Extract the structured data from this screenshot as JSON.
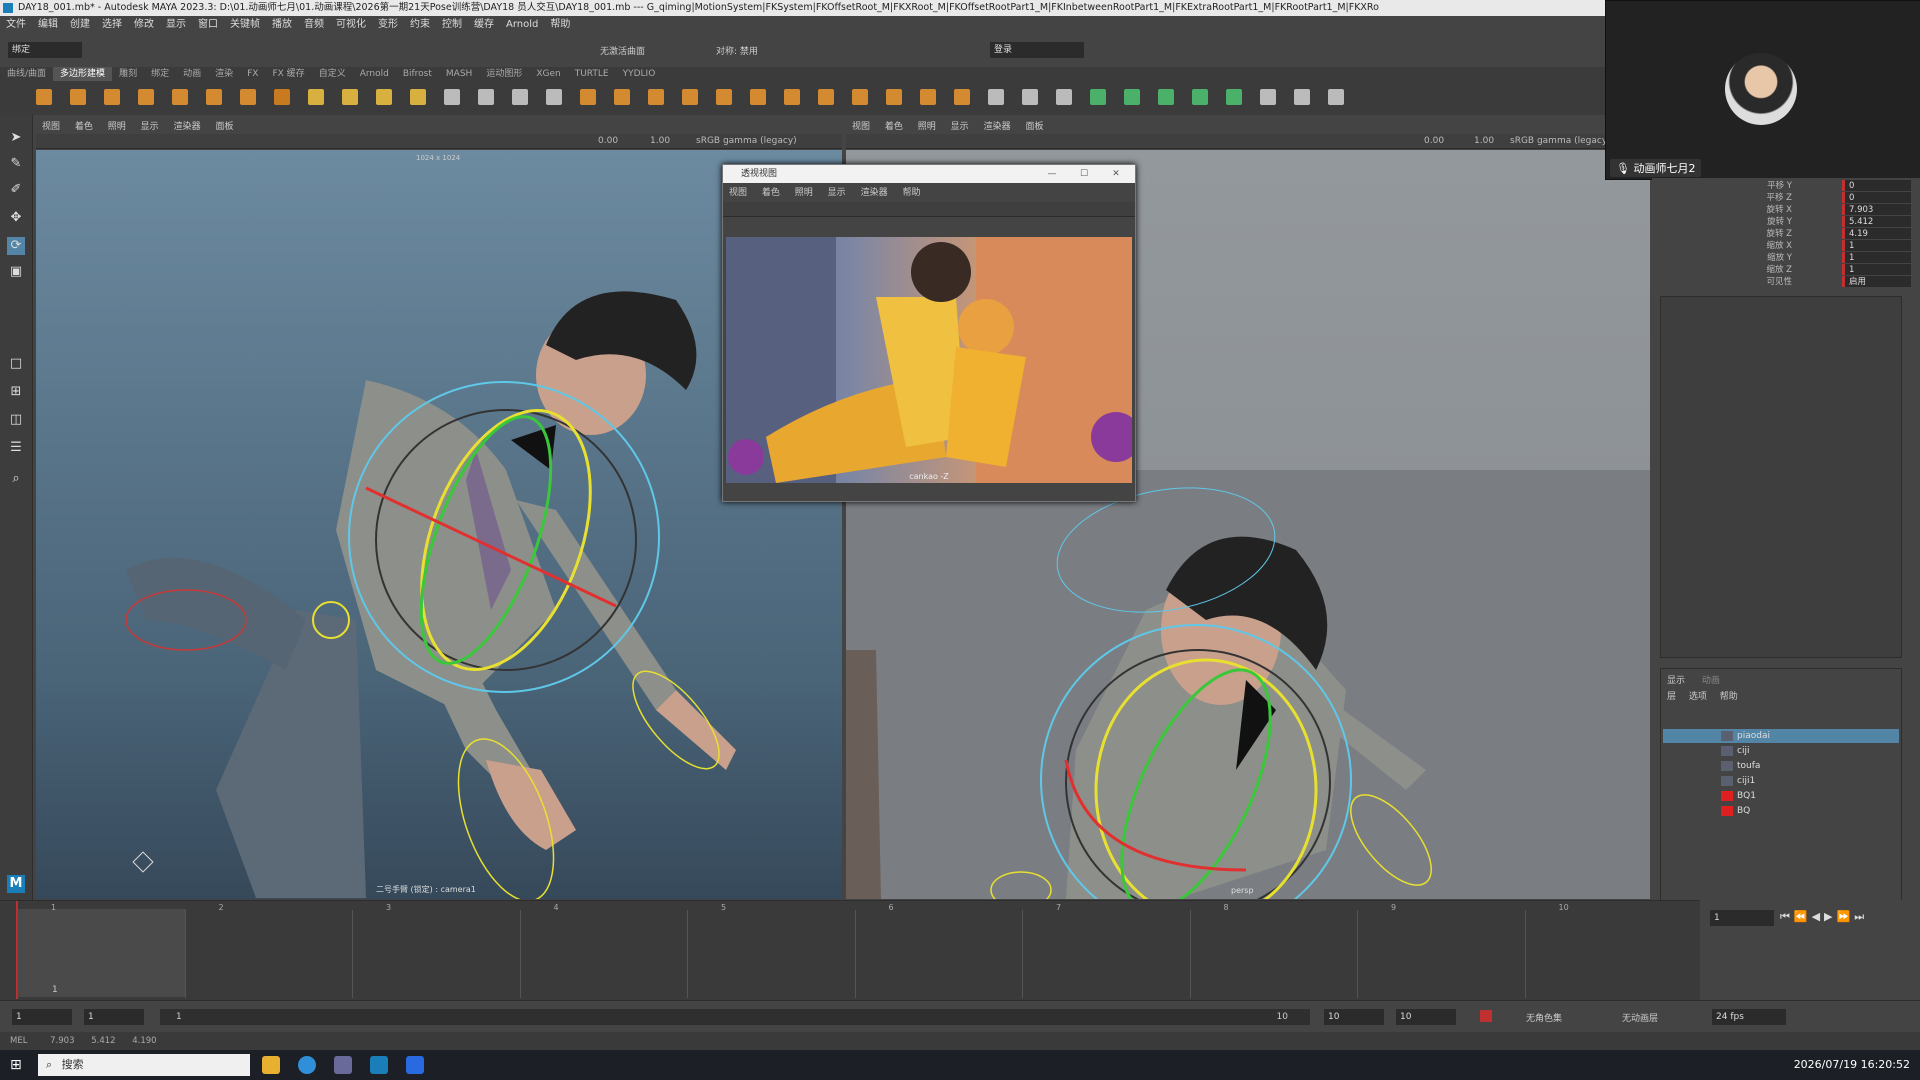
{
  "title_bar": "DAY18_001.mb* - Autodesk MAYA 2023.3: D:\\01.动画师七月\\01.动画课程\\2026第一期21天Pose训练营\\DAY18 员人交互\\DAY18_001.mb  ---  G_qiming|MotionSystem|FKSystem|FKOffsetRoot_M|FKXRoot_M|FKOffsetRootPart1_M|FKInbetweenRootPart1_M|FKExtraRootPart1_M|FKRootPart1_M|FKXRo",
  "menu": [
    "文件",
    "编辑",
    "创建",
    "选择",
    "修改",
    "显示",
    "窗口",
    "关键帧",
    "播放",
    "音频",
    "可视化",
    "变形",
    "约束",
    "控制",
    "缓存",
    "Arnold",
    "帮助"
  ],
  "status_line": {
    "mode": "绑定",
    "symmetry": "无激活曲面",
    "sym_label": "对称: 禁用",
    "login": "登录"
  },
  "shelf_tabs": [
    "曲线/曲面",
    "多边形建模",
    "雕刻",
    "绑定",
    "动画",
    "渲染",
    "FX",
    "FX 缓存",
    "自定义",
    "Arnold",
    "Bifrost",
    "MASH",
    "运动图形",
    "XGen",
    "TURTLE",
    "YYDLIO"
  ],
  "shelf_active_tab": "多边形建模",
  "viewport1": {
    "menus": [
      "视图",
      "着色",
      "照明",
      "显示",
      "渲染器",
      "面板"
    ],
    "gamma": "sRGB gamma (legacy)",
    "val_a": "0.00",
    "val_b": "1.00",
    "resolution": "1024 x 1024",
    "camera": "二号手臂 (锁定) : camera1"
  },
  "viewport2": {
    "menus": [
      "视图",
      "着色",
      "照明",
      "显示",
      "渲染器",
      "面板"
    ],
    "gamma": "sRGB gamma (legacy)",
    "val_a": "0.00",
    "val_b": "1.00",
    "camera": "persp"
  },
  "ref_window": {
    "title": "透视视图",
    "menus": [
      "视图",
      "着色",
      "照明",
      "显示",
      "渲染器",
      "帮助"
    ],
    "caption": "cankao -Z"
  },
  "video": {
    "name": "动画师七月2"
  },
  "channel_box": [
    {
      "label": "平移 Y",
      "value": "0"
    },
    {
      "label": "平移 Z",
      "value": "0"
    },
    {
      "label": "旋转 X",
      "value": "7.903"
    },
    {
      "label": "旋转 Y",
      "value": "5.412"
    },
    {
      "label": "旋转 Z",
      "value": "4.19"
    },
    {
      "label": "缩放 X",
      "value": "1"
    },
    {
      "label": "缩放 Y",
      "value": "1"
    },
    {
      "label": "缩放 Z",
      "value": "1"
    },
    {
      "label": "可见性",
      "value": "启用"
    }
  ],
  "layer_editor": {
    "tabs": [
      "显示",
      "动画"
    ],
    "menus": [
      "层",
      "选项",
      "帮助"
    ],
    "layers": [
      {
        "name": "piaodai",
        "color": "#5a6070",
        "selected": true
      },
      {
        "name": "ciji",
        "color": "#5a6070",
        "selected": false
      },
      {
        "name": "toufa",
        "color": "#5a6070",
        "selected": false
      },
      {
        "name": "ciji1",
        "color": "#5a6070",
        "selected": false
      },
      {
        "name": "BQ1",
        "color": "#e02020",
        "selected": false
      },
      {
        "name": "BQ",
        "color": "#e02020",
        "selected": false
      }
    ]
  },
  "timeline": {
    "ticks": [
      "1",
      "2",
      "3",
      "4",
      "5",
      "6",
      "7",
      "8",
      "9",
      "10"
    ],
    "current_frame_marker": "1",
    "current_frame_field": "1"
  },
  "range": {
    "start": "1",
    "start2": "1",
    "slider_start": "1",
    "slider_end": "10",
    "end": "10",
    "end2": "10",
    "char_set": "无角色集",
    "anim_layer": "无动画层",
    "fps": "24 fps"
  },
  "cmdline": {
    "label": "MEL",
    "vals": [
      "7.903",
      "5.412",
      "4.190"
    ]
  },
  "taskbar": {
    "search": "搜索",
    "datetime": "2026/07/19 16:20:52"
  }
}
